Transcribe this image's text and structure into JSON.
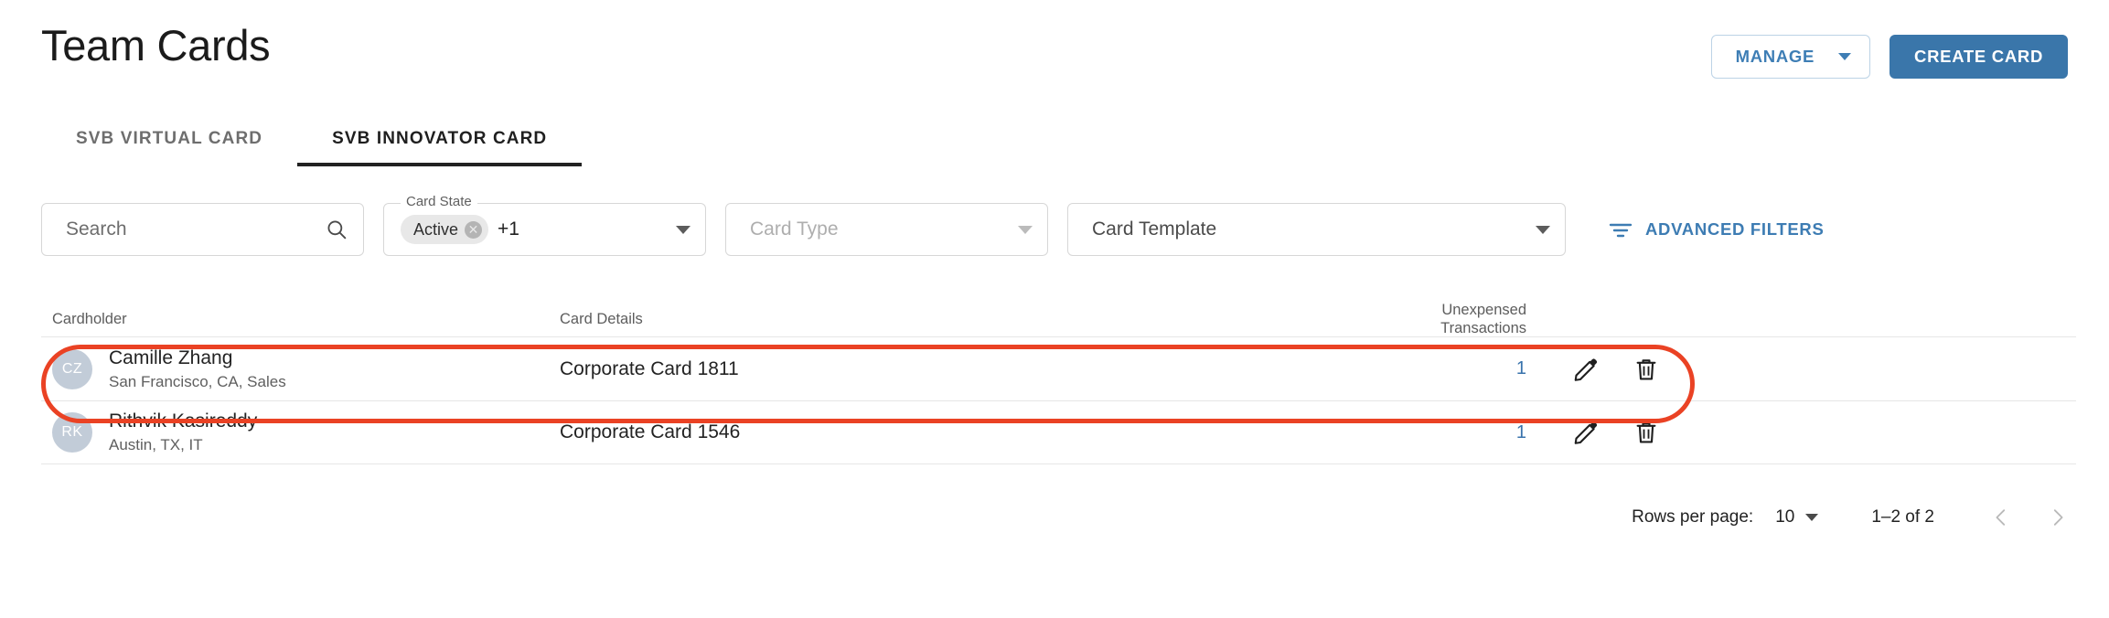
{
  "header": {
    "title": "Team Cards",
    "manage_label": "MANAGE",
    "create_label": "CREATE CARD",
    "manage_caret_icon": "chevron-down-icon"
  },
  "tabs": [
    {
      "label": "SVB VIRTUAL CARD",
      "active": false
    },
    {
      "label": "SVB INNOVATOR CARD",
      "active": true
    }
  ],
  "filters": {
    "search": {
      "placeholder": "Search",
      "value": "",
      "icon": "search-icon"
    },
    "card_state": {
      "legend": "Card State",
      "chip_label": "Active",
      "chip_remove_icon": "close-circle-icon",
      "overflow": "+1",
      "caret_icon": "chevron-down-icon"
    },
    "card_type": {
      "placeholder": "Card Type",
      "value": "",
      "caret_icon": "chevron-down-icon"
    },
    "card_template": {
      "placeholder": "Card Template",
      "value": "",
      "caret_icon": "chevron-down-icon"
    },
    "advanced_filters": {
      "label": "ADVANCED FILTERS",
      "icon": "filter-list-icon"
    }
  },
  "table": {
    "columns": {
      "cardholder": "Cardholder",
      "card_details": "Card Details",
      "unexpensed": "Unexpensed Transactions"
    },
    "rows": [
      {
        "initials": "CZ",
        "name": "Camille Zhang",
        "subtitle": "San Francisco, CA, Sales",
        "card_details": "Corporate Card 1811",
        "unexpensed": "1",
        "edit_icon": "pencil-icon",
        "delete_icon": "trash-icon",
        "highlighted": true
      },
      {
        "initials": "RK",
        "name": "Rithvik Kasireddy",
        "subtitle": "Austin, TX, IT",
        "card_details": "Corporate Card 1546",
        "unexpensed": "1",
        "edit_icon": "pencil-icon",
        "delete_icon": "trash-icon",
        "highlighted": false
      }
    ]
  },
  "pagination": {
    "rows_per_page_label": "Rows per page:",
    "rows_per_page_value": "10",
    "range": "1–2 of 2",
    "prev_icon": "chevron-left-icon",
    "next_icon": "chevron-right-icon"
  },
  "colors": {
    "primary": "#3a76aa",
    "link": "#3973ac",
    "annotation": "#ea4224",
    "avatar_bg": "#c2ccd8",
    "text": "#232323"
  }
}
